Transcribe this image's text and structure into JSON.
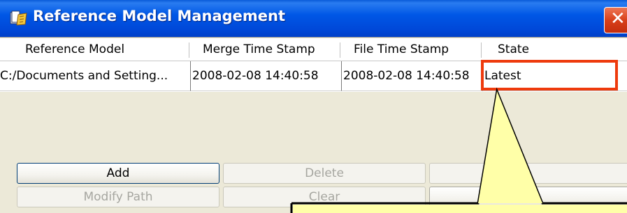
{
  "window": {
    "title": "Reference Model Management",
    "close_label": "✕"
  },
  "table": {
    "columns": [
      "Reference Model",
      "Merge Time Stamp",
      "File Time Stamp",
      "State"
    ],
    "rows": [
      [
        "C:/Documents and Setting...",
        "2008-02-08 14:40:58",
        "2008-02-08 14:40:58",
        "Latest"
      ]
    ]
  },
  "buttons": {
    "add": "Add",
    "delete": "Delete",
    "modify_path": "Modify Path",
    "clear": "Clear"
  },
  "colors": {
    "titlebar": "#0054e3",
    "highlight": "#ee3a0c",
    "callout_fill": "#ffffa8"
  }
}
